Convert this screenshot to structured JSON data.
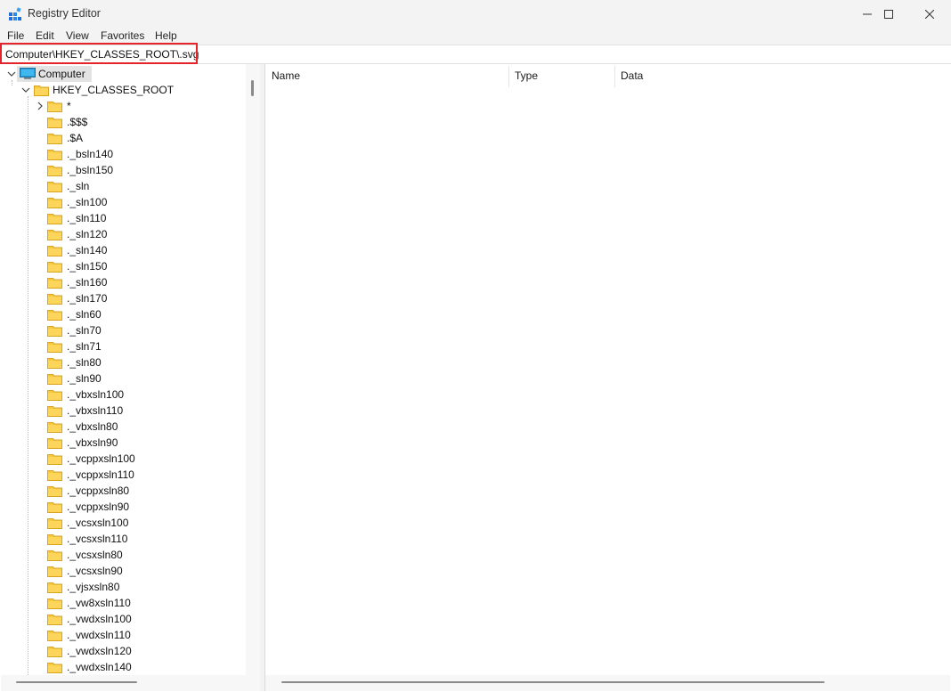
{
  "window": {
    "title": "Registry Editor",
    "icon": "registry-icon",
    "controls": [
      "minimize-icon",
      "maximize-icon",
      "close-icon"
    ]
  },
  "menu": {
    "file": "File",
    "edit": "Edit",
    "view": "View",
    "favorites": "Favorites",
    "help": "Help"
  },
  "address": {
    "path": "Computer\\HKEY_CLASSES_ROOT\\.svg",
    "highlight_color": "#e3242b"
  },
  "tree": {
    "computer": "Computer",
    "root": "HKEY_CLASSES_ROOT",
    "children": [
      "*",
      ".$$$",
      ".$A",
      "._bsln140",
      "._bsln150",
      "._sln",
      "._sln100",
      "._sln110",
      "._sln120",
      "._sln140",
      "._sln150",
      "._sln160",
      "._sln170",
      "._sln60",
      "._sln70",
      "._sln71",
      "._sln80",
      "._sln90",
      "._vbxsln100",
      "._vbxsln110",
      "._vbxsln80",
      "._vbxsln90",
      "._vcppxsln100",
      "._vcppxsln110",
      "._vcppxsln80",
      "._vcppxsln90",
      "._vcsxsln100",
      "._vcsxsln110",
      "._vcsxsln80",
      "._vcsxsln90",
      "._vjsxsln80",
      "._vw8xsln110",
      "._vwdxsln100",
      "._vwdxsln110",
      "._vwdxsln120",
      "._vwdxsln140"
    ]
  },
  "values": {
    "columns": {
      "name": "Name",
      "type": "Type",
      "data": "Data"
    }
  },
  "colors": {
    "folder": "#f6c940",
    "selection": "#e3e3e3",
    "chrome": "#f3f3f3"
  }
}
